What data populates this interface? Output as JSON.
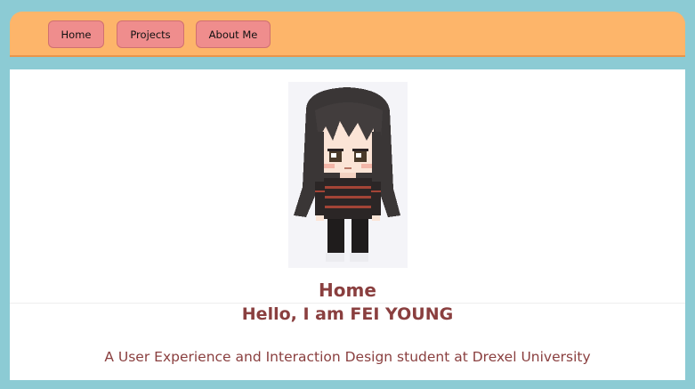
{
  "nav": {
    "items": [
      {
        "label": "Home"
      },
      {
        "label": "Projects"
      },
      {
        "label": "About Me"
      }
    ]
  },
  "main": {
    "page_title": "Home",
    "greeting": "Hello, I am FEI YOUNG",
    "tagline": "A User Experience and Interaction Design student at Drexel University"
  },
  "colors": {
    "frame": "#8ccbd4",
    "navbar": "#fdb56a",
    "nav_button": "#ef8d8d",
    "heading_text": "#8a3f3f"
  }
}
